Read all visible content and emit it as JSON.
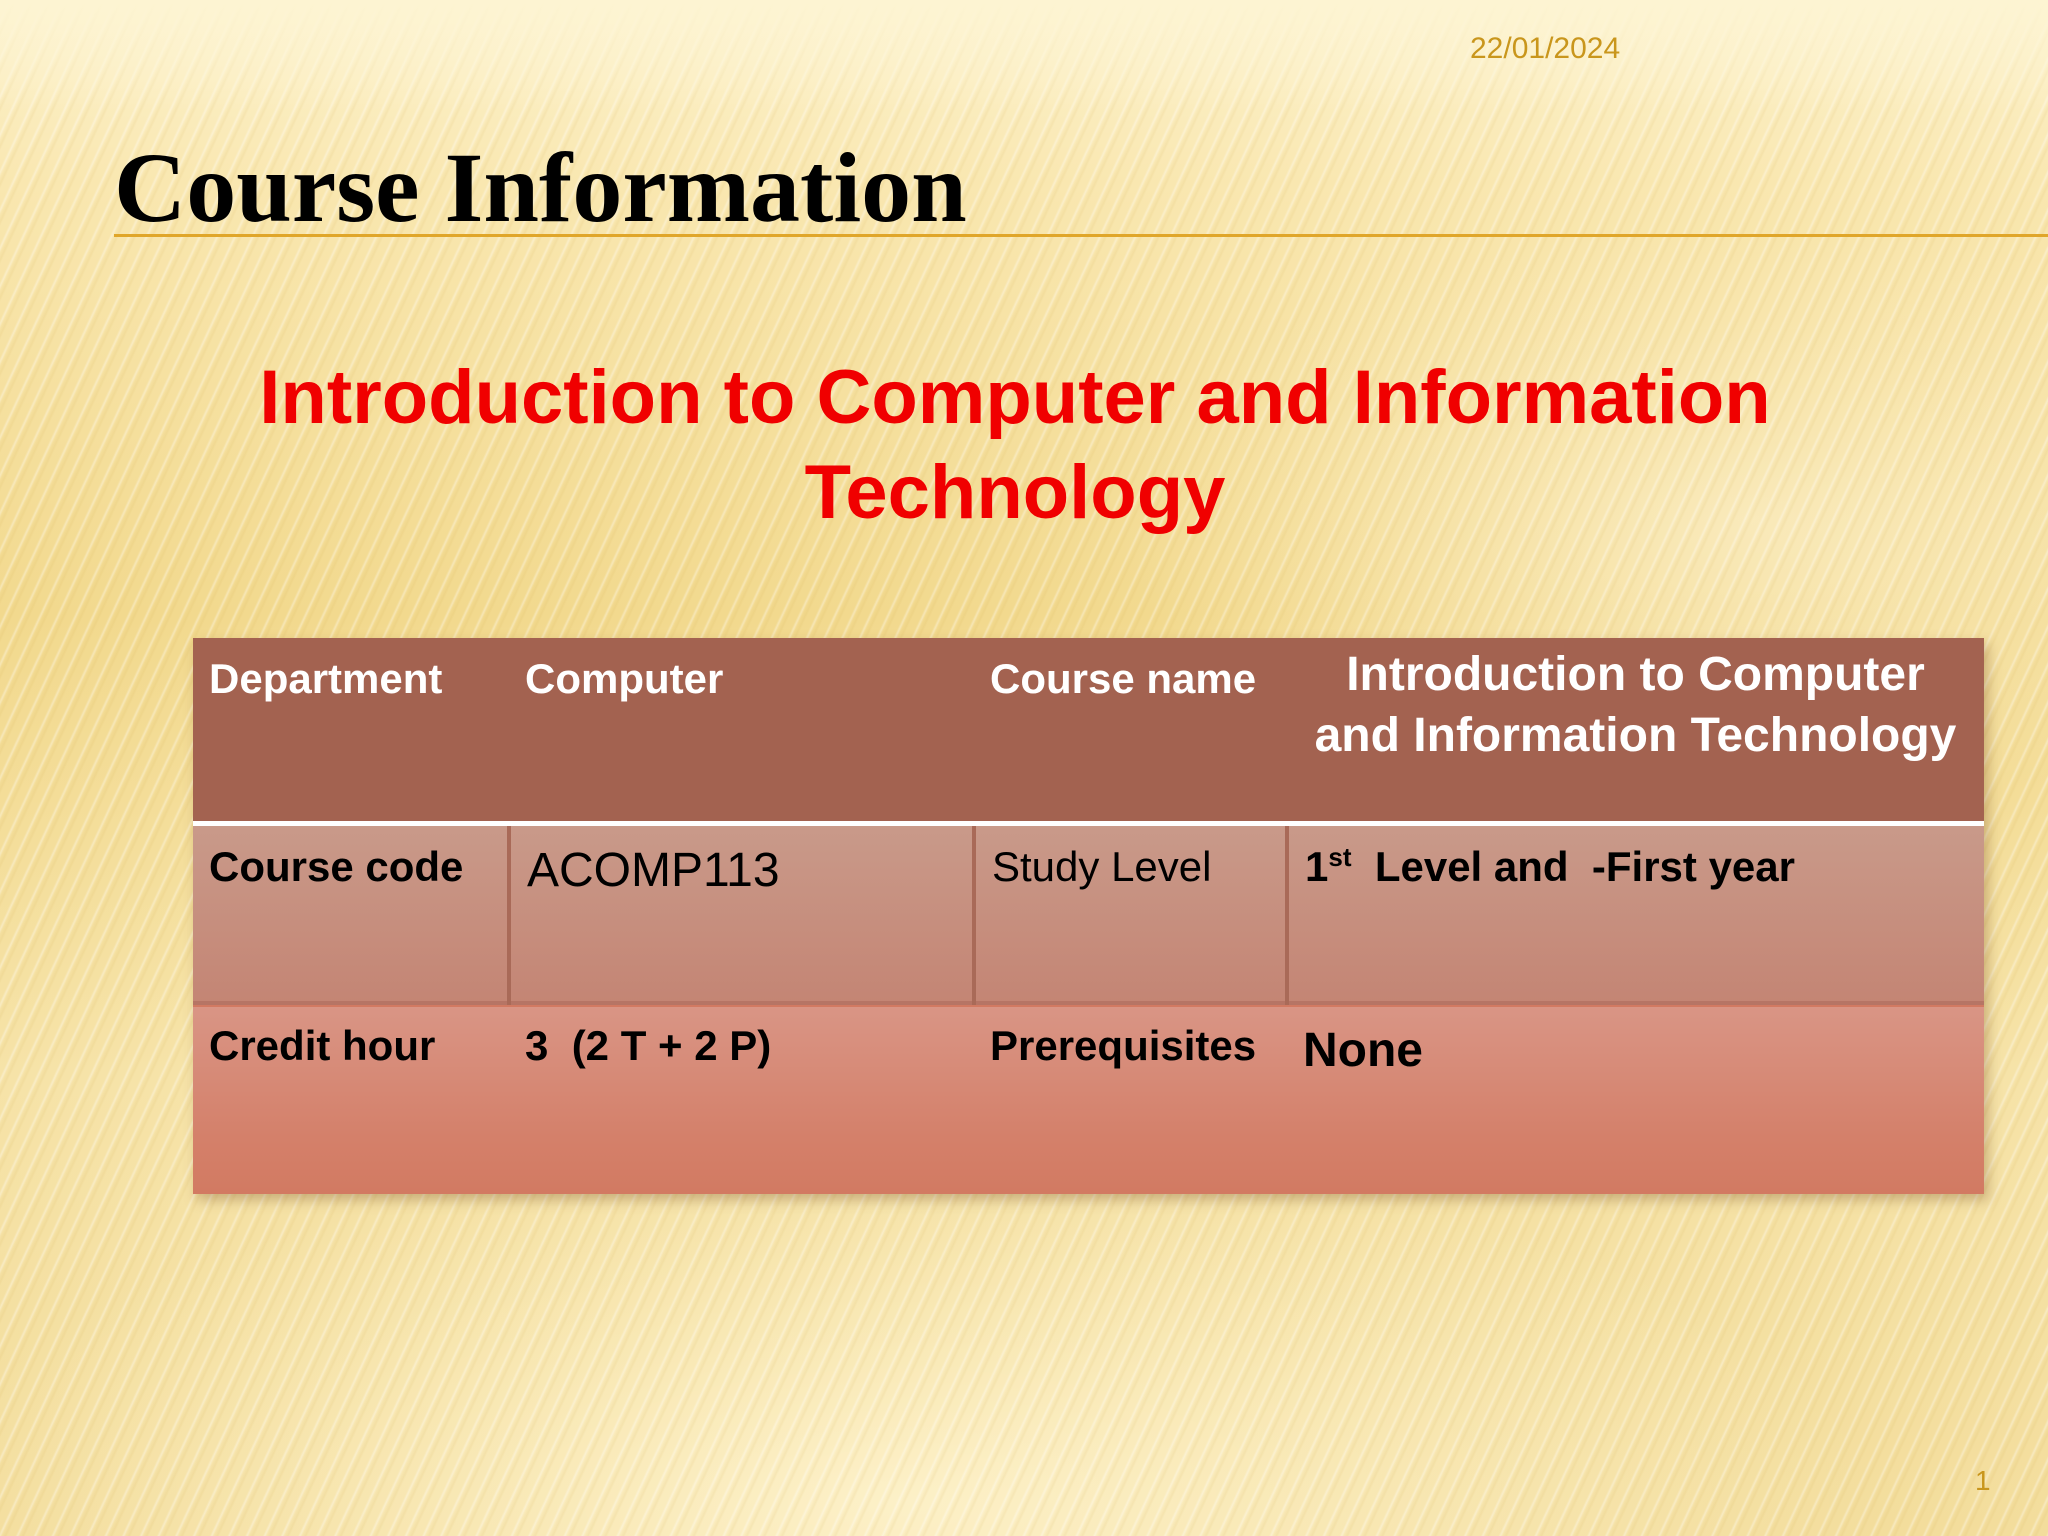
{
  "slide": {
    "date": "22/01/2024",
    "title": "Course Information",
    "subtitle": "Introduction to Computer and Information Technology",
    "page_number": "1"
  },
  "table": {
    "rows": [
      {
        "label1": "Department",
        "value1": "Computer",
        "label2": "Course name",
        "value2": "Introduction to Computer and Information Technology"
      },
      {
        "label1": "Course code",
        "value1": "ACOMP113",
        "label2": "Study Level",
        "value2_prefix": "1",
        "value2_sup": "st",
        "value2_rest": "  Level and  -First year"
      },
      {
        "label1": "Credit hour",
        "value1": "3  (2 T + 2 P)",
        "label2": "Prerequisites",
        "value2": "None"
      }
    ]
  },
  "colors": {
    "title": "#000000",
    "subtitle": "#f00000",
    "accent_line": "#e0a62a",
    "header_row": "#a36250",
    "row_light": "#c99a8a",
    "row_salmon": "#d4806a"
  }
}
